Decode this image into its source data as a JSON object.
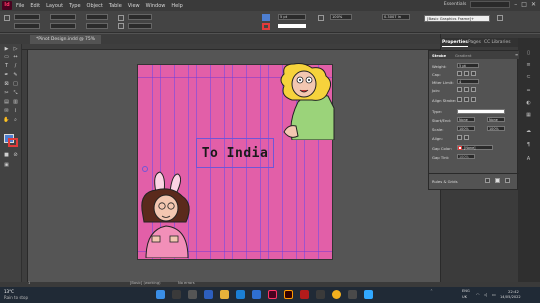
{
  "app": {
    "logo": "Id",
    "menu": [
      "File",
      "Edit",
      "Layout",
      "Type",
      "Object",
      "Table",
      "View",
      "Window",
      "Help"
    ],
    "workspace": "Essentials"
  },
  "control": {
    "weight_value": "5 pt",
    "scale_value": "100%",
    "opacity_value": "0.3007 in",
    "frame_style": "[Basic Graphics Frame]+"
  },
  "document": {
    "tab_title": "*Pinot Design.indd @ 75%",
    "page_text": "To India"
  },
  "panels": {
    "tabs": [
      "Properties",
      "Pages",
      "CC Libraries"
    ],
    "stroke_title": "Stroke",
    "swatch_label": "Gradient",
    "stroke": {
      "weight_label": "Weight:",
      "weight_value": "5 pt",
      "cap_label": "Cap:",
      "miter_label": "Miter Limit:",
      "miter_value": "4",
      "join_label": "Join:",
      "align_label": "Align Stroke:",
      "type_label": "Type:",
      "start_label": "Start/End:",
      "start_value": "None",
      "end_value": "None",
      "scale_label": "Scale:",
      "scale1": "100%",
      "scale2": "100%",
      "align2_label": "Align:",
      "gap_color_label": "Gap Color:",
      "gap_color_value": "[None]",
      "gap_tint_label": "Gap Tint:",
      "gap_tint_value": "100%"
    },
    "section_label": "Rules & Grids"
  },
  "status": {
    "page": "1",
    "style": "[Basic] (working)",
    "errors": "No errors"
  },
  "taskbar": {
    "weather_temp": "13°C",
    "weather_text": "Rain to stop",
    "search_placeholder": "Search",
    "lang1": "ENG",
    "lang2": "UK",
    "time": "22:42",
    "date": "14/05/2022"
  },
  "colors": {
    "page_pink": "#e25fa8",
    "guide_purple": "#8a4fd9",
    "accent_magenta": "#ff3366"
  }
}
